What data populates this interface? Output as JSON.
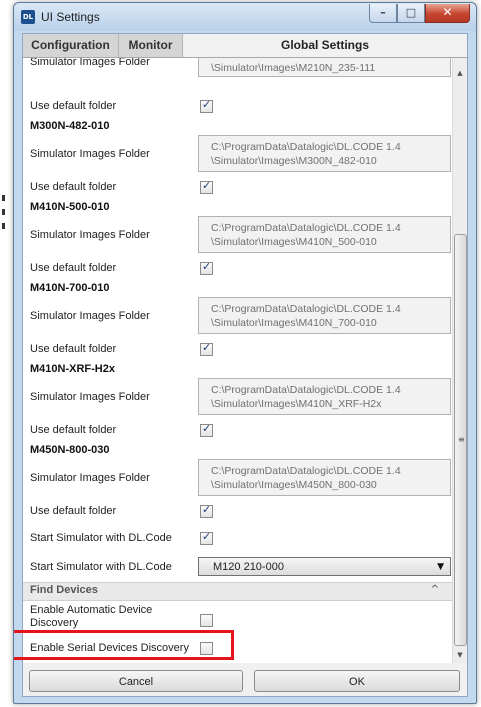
{
  "window": {
    "title": "UI Settings",
    "app_icon_text": "DL"
  },
  "tabs": [
    {
      "label": "Configuration"
    },
    {
      "label": "Monitor"
    },
    {
      "label": "Global Settings"
    }
  ],
  "settings": {
    "first_folder_label": "Simulator Images Folder",
    "first_folder_value": "\\Simulator\\Images\\M210N_235-111",
    "first_use_default_label": "Use default folder",
    "models": [
      {
        "name": "M300N-482-010",
        "folder_label": "Simulator Images Folder",
        "folder_line1": "C:\\ProgramData\\Datalogic\\DL.CODE 1.4",
        "folder_line2": "\\Simulator\\Images\\M300N_482-010",
        "use_default_label": "Use default folder"
      },
      {
        "name": "M410N-500-010",
        "folder_label": "Simulator Images Folder",
        "folder_line1": "C:\\ProgramData\\Datalogic\\DL.CODE 1.4",
        "folder_line2": "\\Simulator\\Images\\M410N_500-010",
        "use_default_label": "Use default folder"
      },
      {
        "name": "M410N-700-010",
        "folder_label": "Simulator Images Folder",
        "folder_line1": "C:\\ProgramData\\Datalogic\\DL.CODE 1.4",
        "folder_line2": "\\Simulator\\Images\\M410N_700-010",
        "use_default_label": "Use default folder"
      },
      {
        "name": "M410N-XRF-H2x",
        "folder_label": "Simulator Images Folder",
        "folder_line1": "C:\\ProgramData\\Datalogic\\DL.CODE 1.4",
        "folder_line2": "\\Simulator\\Images\\M410N_XRF-H2x",
        "use_default_label": "Use default folder"
      },
      {
        "name": "M450N-800-030",
        "folder_label": "Simulator Images Folder",
        "folder_line1": "C:\\ProgramData\\Datalogic\\DL.CODE 1.4",
        "folder_line2": "\\Simulator\\Images\\M450N_800-030",
        "use_default_label": "Use default folder"
      }
    ],
    "start_simulator_label": "Start Simulator with DL.Code",
    "start_simulator_model_label": "Start Simulator with DL.Code",
    "start_simulator_model_value": "M120 210-000"
  },
  "find_devices": {
    "section_title": "Find Devices",
    "auto_discovery_label": "Enable Automatic Device Discovery",
    "serial_discovery_label": "Enable Serial Devices Discovery"
  },
  "footer": {
    "cancel_label": "Cancel",
    "ok_label": "OK"
  },
  "colors": {
    "highlight": "#e3141b",
    "title_bar": "#c2d8ee",
    "close_button": "#c7452f"
  }
}
